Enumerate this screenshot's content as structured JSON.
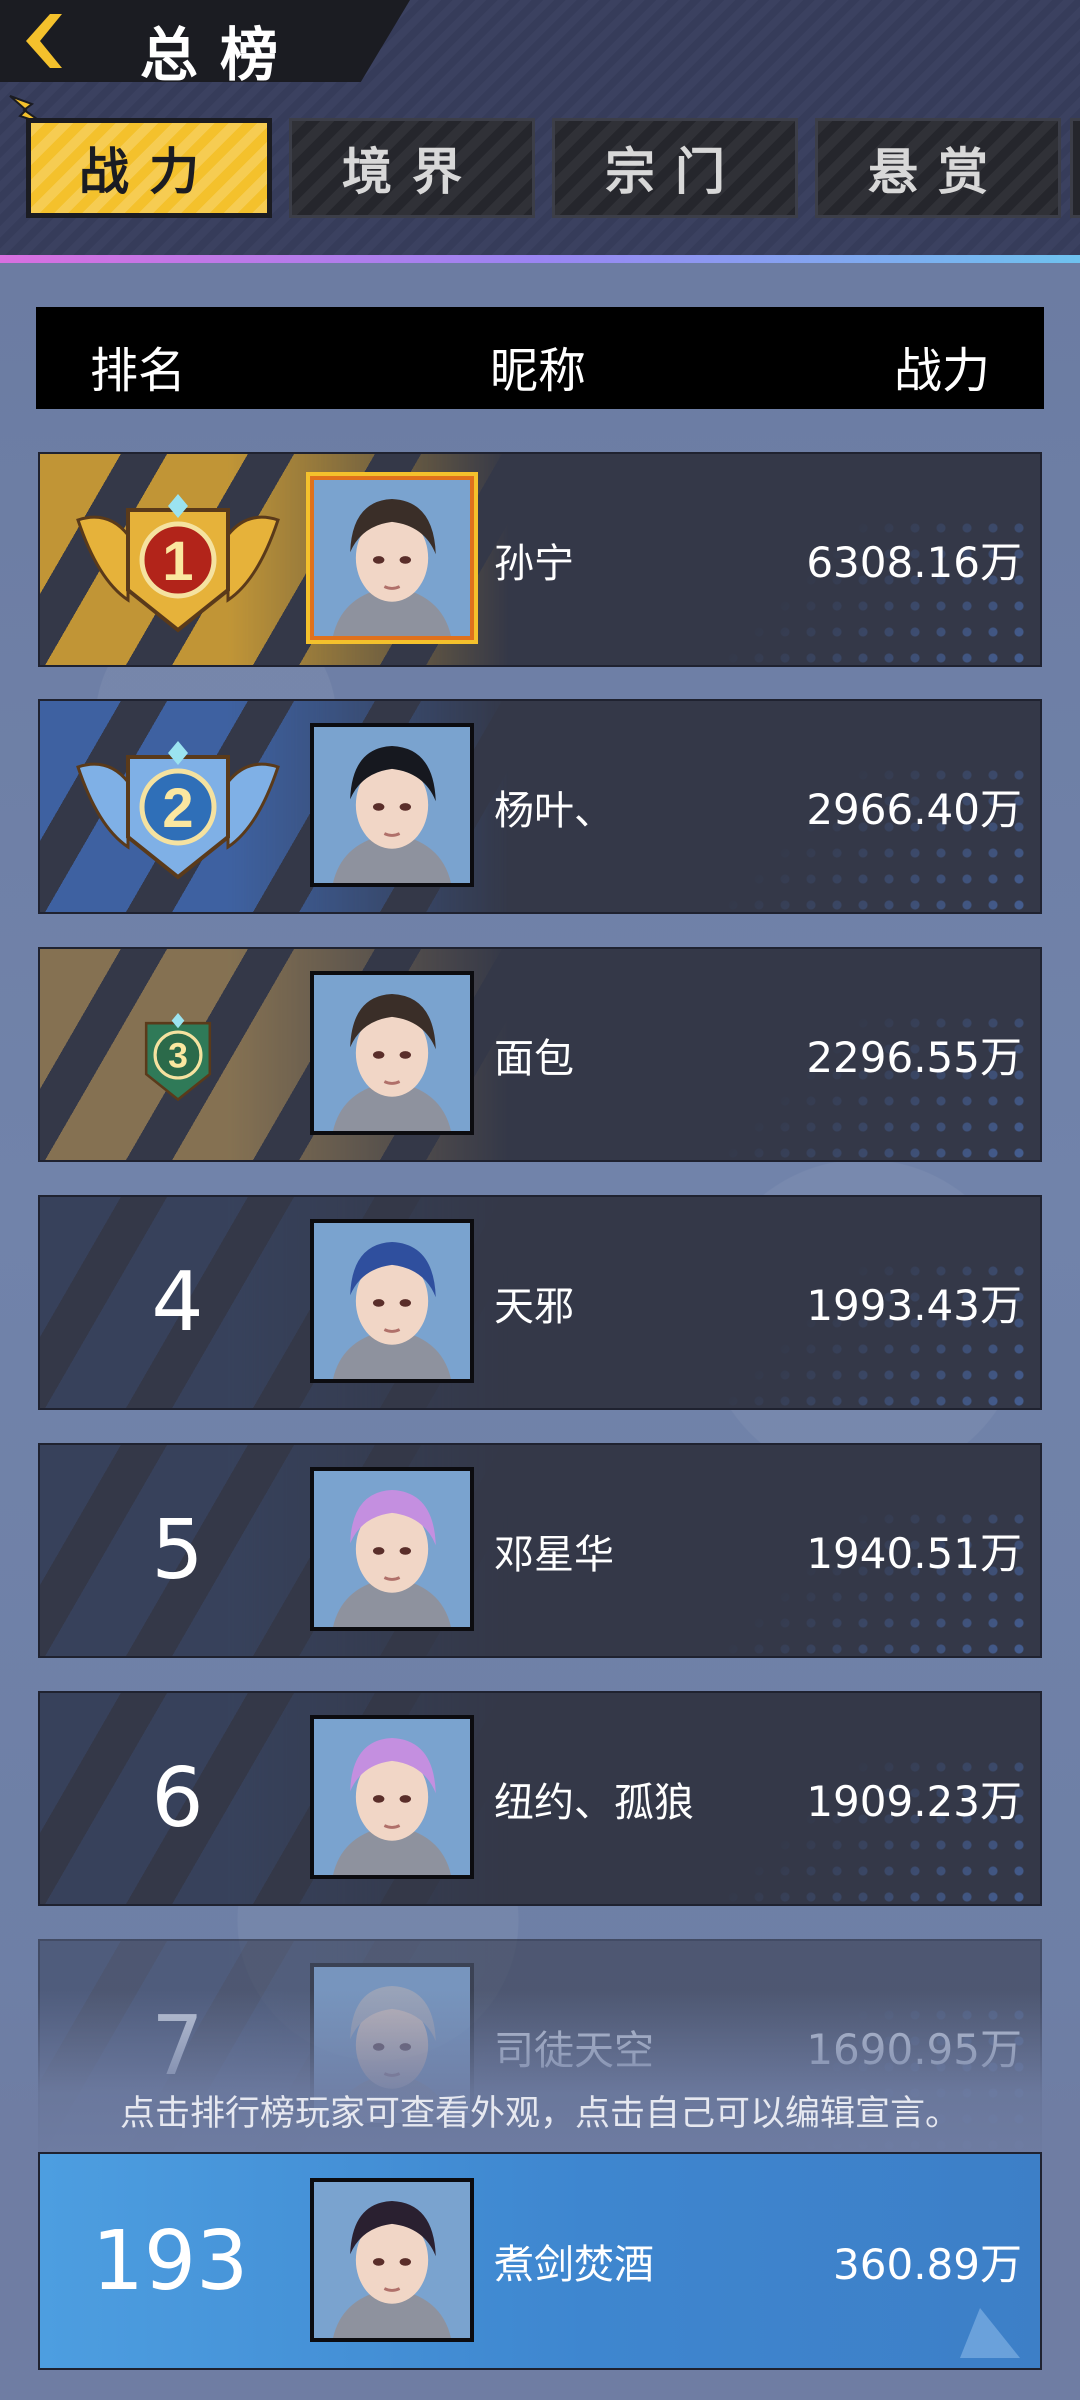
{
  "header": {
    "title": "总榜",
    "tabs": [
      {
        "label": "战力",
        "active": true
      },
      {
        "label": "境界",
        "active": false
      },
      {
        "label": "宗门",
        "active": false
      },
      {
        "label": "悬赏",
        "active": false
      }
    ]
  },
  "columns": {
    "rank": "排名",
    "nickname": "昵称",
    "power": "战力"
  },
  "rows": [
    {
      "rank": "1",
      "name": "孙宁",
      "power": "6308.16万",
      "hair": "#3a2e28"
    },
    {
      "rank": "2",
      "name": "杨叶、",
      "power": "2966.40万",
      "hair": "#16181f"
    },
    {
      "rank": "3",
      "name": "面包",
      "power": "2296.55万",
      "hair": "#3a2e28"
    },
    {
      "rank": "4",
      "name": "天邪",
      "power": "1993.43万",
      "hair": "#2f4f9e"
    },
    {
      "rank": "5",
      "name": "邓星华",
      "power": "1940.51万",
      "hair": "#c48fe0"
    },
    {
      "rank": "6",
      "name": "纽约、孤狼",
      "power": "1909.23万",
      "hair": "#c48fe0"
    },
    {
      "rank": "7",
      "name": "司徒天空",
      "power": "1690.95万",
      "hair": "#b8bcc6"
    }
  ],
  "hint": "点击排行榜玩家可查看外观，点击自己可以编辑宣言。",
  "self": {
    "rank": "193",
    "name": "煮剑焚酒",
    "power": "360.89万",
    "hair": "#2a2030"
  },
  "colors": {
    "tab_active": "#f4c12c",
    "gold": "#e6b23a",
    "silver": "#7fb0e6",
    "bronze": "#2f7a58"
  }
}
